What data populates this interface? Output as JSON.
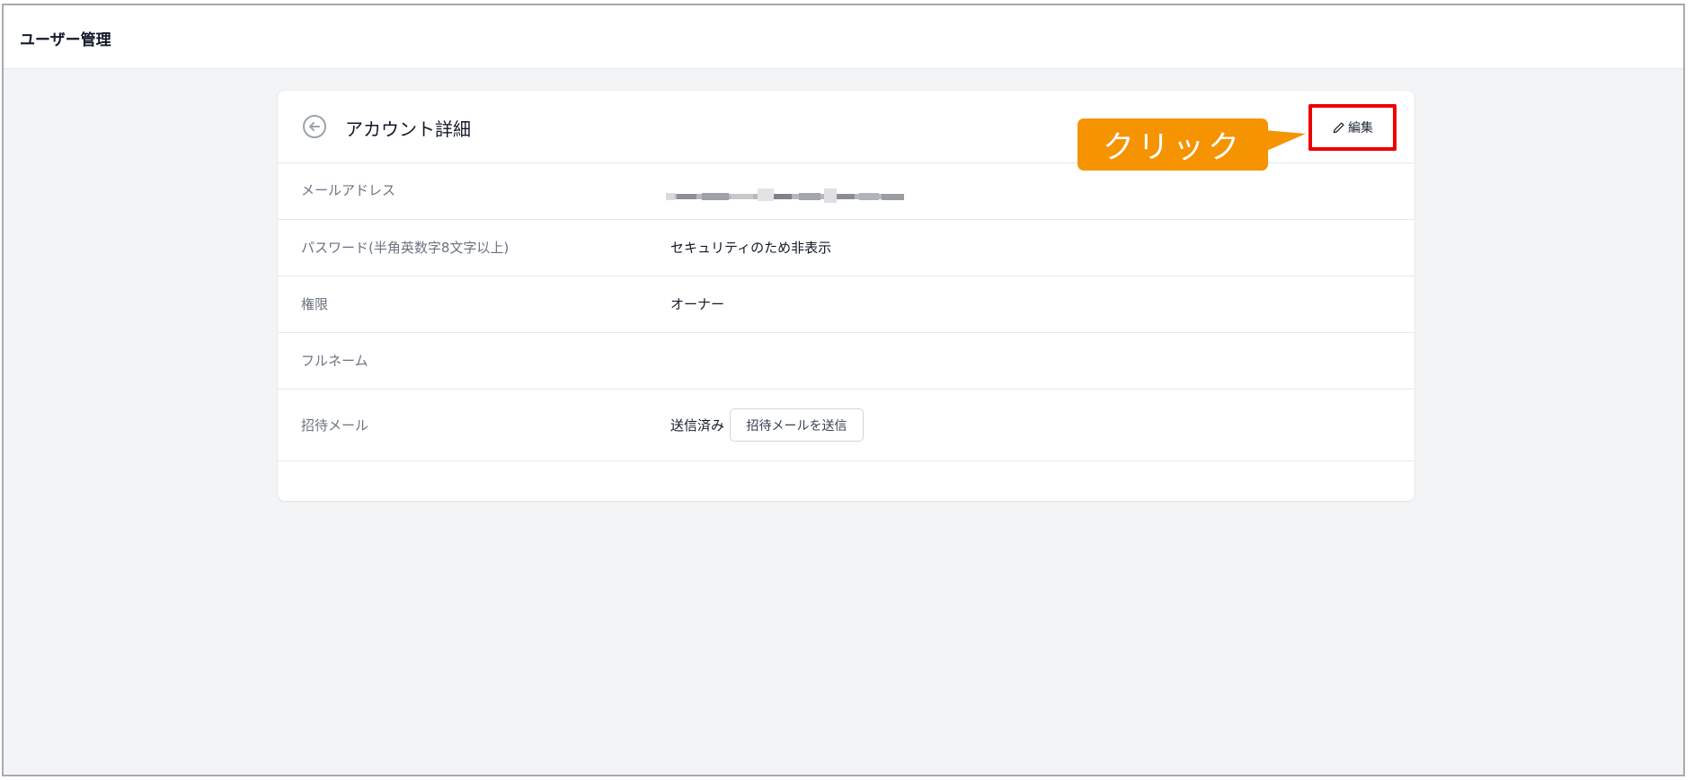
{
  "header": {
    "title": "ユーザー管理"
  },
  "card": {
    "title": "アカウント詳細",
    "edit_label": "編集",
    "rows": [
      {
        "label": "メールアドレス",
        "value": ""
      },
      {
        "label": "パスワード(半角英数字8文字以上)",
        "value": "セキュリティのため非表示"
      },
      {
        "label": "権限",
        "value": "オーナー"
      },
      {
        "label": "フルネーム",
        "value": ""
      },
      {
        "label": "招待メール",
        "value": "送信済み",
        "button_label": "招待メールを送信"
      }
    ]
  },
  "annotation": {
    "callout_text": "クリック",
    "callout_color": "#f59300",
    "highlight_color": "#ee0000"
  },
  "icons": {
    "back": "arrow-left-circle-icon",
    "edit": "pencil-icon"
  }
}
